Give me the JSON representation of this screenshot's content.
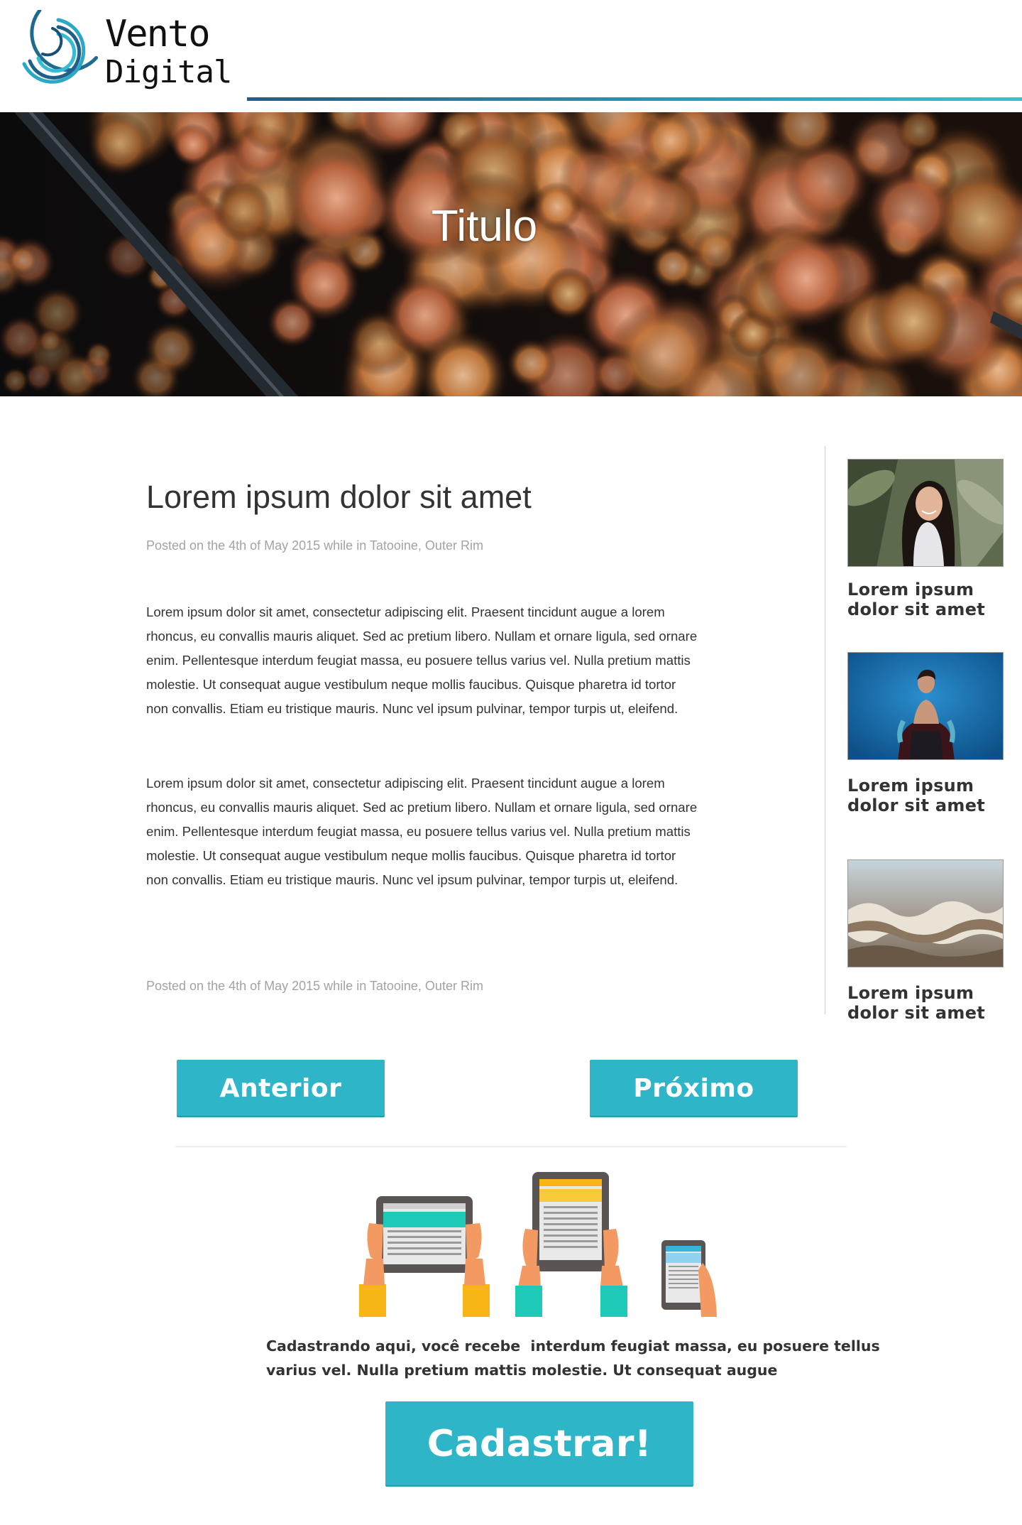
{
  "brand": {
    "name_line1": "Vento",
    "name_line2": "Digital",
    "logo_icon": "concentric-arcs-icon",
    "accent_color": "#2fb5c8",
    "rule_colors": [
      "#1f5f8a",
      "#3cc0d6"
    ]
  },
  "hero": {
    "title": "Titulo",
    "image": "aerial-autumn-forest-road"
  },
  "article": {
    "title": "Lorem ipsum dolor sit amet",
    "meta_top": "Posted on the 4th of May 2015 while in Tatooine, Outer Rim",
    "paragraphs": [
      "Lorem ipsum dolor sit amet, consectetur adipiscing elit. Praesent tincidunt augue a lorem rhoncus, eu convallis mauris aliquet. Sed ac pretium libero. Nullam et ornare ligula, sed ornare enim. Pellentesque interdum feugiat massa, eu posuere tellus varius vel. Nulla pretium mattis molestie. Ut consequat augue vestibulum neque mollis faucibus. Quisque pharetra id tortor non convallis. Etiam eu tristique mauris. Nunc vel ipsum pulvinar, tempor turpis ut, eleifend.",
      "Lorem ipsum dolor sit amet, consectetur adipiscing elit. Praesent tincidunt augue a lorem rhoncus, eu convallis mauris aliquet. Sed ac pretium libero. Nullam et ornare ligula, sed ornare enim. Pellentesque interdum feugiat massa, eu posuere tellus varius vel. Nulla pretium mattis molestie. Ut consequat augue vestibulum neque mollis faucibus. Quisque pharetra id tortor non convallis. Etiam eu tristique mauris. Nunc vel ipsum pulvinar, tempor turpis ut, eleifend."
    ],
    "meta_bottom": "Posted on the 4th of May 2015 while in Tatooine, Outer Rim"
  },
  "sidebar": {
    "items": [
      {
        "caption_line1": "Lorem ipsum",
        "caption_line2": "dolor sit amet",
        "image": "smiling-woman-photo"
      },
      {
        "caption_line1": "Lorem ipsum",
        "caption_line2": "dolor sit amet",
        "image": "man-blue-background-photo"
      },
      {
        "caption_line1": "Lorem ipsum",
        "caption_line2": "dolor sit amet",
        "image": "ocean-foam-photo"
      }
    ]
  },
  "pagination": {
    "prev_label": "Anterior",
    "next_label": "Próximo"
  },
  "signup": {
    "illustration": "hands-holding-devices-illustration",
    "text_line1": "Cadastrando aqui, você recebe  interdum feugiat massa, eu posuere tellus",
    "text_line2": "varius vel. Nulla pretium mattis molestie. Ut consequat augue",
    "button_label": "Cadastrar!"
  }
}
